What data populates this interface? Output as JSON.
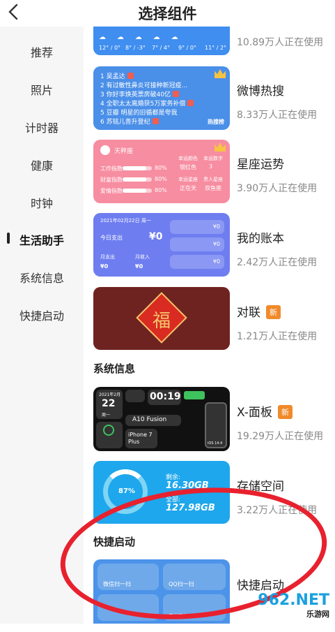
{
  "header": {
    "back_icon": "chevron-left",
    "title": "选择组件"
  },
  "sidebar": {
    "items": [
      {
        "label": "推荐"
      },
      {
        "label": "照片"
      },
      {
        "label": "计时器"
      },
      {
        "label": "健康"
      },
      {
        "label": "时钟"
      },
      {
        "label": "生活助手",
        "active": true
      },
      {
        "label": "系统信息"
      },
      {
        "label": "快捷启动"
      }
    ]
  },
  "widgets": [
    {
      "name": "",
      "users": "10.89万人正在使用"
    },
    {
      "name": "微博热搜",
      "users": "8.33万人正在使用"
    },
    {
      "name": "星座运势",
      "users": "3.90万人正在使用"
    },
    {
      "name": "我的账本",
      "users": "2.42万人正在使用"
    },
    {
      "name": "对联",
      "badge": "新",
      "users": "1.21万人正在使用"
    },
    {
      "name": "X-面板",
      "badge": "新",
      "users": "19.29万人正在使用"
    },
    {
      "name": "存储空间",
      "users": "3.22万人正在使用"
    },
    {
      "name": "快捷启动",
      "users": ""
    }
  ],
  "sections": {
    "system_info": "系统信息",
    "quick_launch": "快捷启动"
  },
  "weather_preview": {
    "temps": [
      "12° / 0°",
      "8° / -3°",
      "7° / 4°",
      "9° / 0°",
      "11° / 2°"
    ]
  },
  "weibo_preview": {
    "items": [
      "1 吴孟达",
      "2 有过敏性鼻炎可接种新冠疫...",
      "3 你好李焕英票房破40亿",
      "4 全职太太离婚获5万家务补偿",
      "5 豆瓣 明星的旧循都是夸我",
      "6 苏铭儿善升登纪"
    ],
    "logo_text": "热搜榜"
  },
  "horoscope_preview": {
    "sign": "天秤座",
    "rows": [
      {
        "label": "工作指数",
        "value": 0.8,
        "text": "80%"
      },
      {
        "label": "财富指数",
        "value": 0.8,
        "text": "80%"
      },
      {
        "label": "爱情指数",
        "value": 0.8,
        "text": "80%"
      }
    ],
    "cells": [
      {
        "k": "幸运颜色",
        "v": "银红色"
      },
      {
        "k": "幸运数字",
        "v": "3"
      },
      {
        "k": "幸运星座",
        "v": "正在天"
      },
      {
        "k": "贵人星座",
        "v": "双鱼座"
      }
    ]
  },
  "ledger_preview": {
    "date": "2021年02月22日  周一",
    "today_label": "今日支出",
    "today_value": "¥0",
    "month_out_label": "月支出",
    "month_out": "¥0",
    "month_in_label": "月收入",
    "month_in": "¥0",
    "right_values": [
      "¥0",
      "¥0",
      "¥0"
    ]
  },
  "couplet_preview": {
    "char": "福"
  },
  "xpanel_preview": {
    "date": "2021年2月",
    "day": "22",
    "weekday": "周一",
    "time": "00:19",
    "chip": "A10 Fusion",
    "model": "iPhone 7 Plus",
    "ios": "iOS 14.4"
  },
  "storage_preview": {
    "percent": "87%",
    "used_fraction": 0.87,
    "free_label": "剩余:",
    "free_value": "16.30GB",
    "total_label": "全部:",
    "total_value": "127.98GB"
  },
  "quick_preview": {
    "tiles": [
      "微信扫一扫",
      "QQ扫一扫",
      "",
      "支付宝扫一扫"
    ]
  },
  "watermark": {
    "text": "962.NET",
    "sub": "乐游网"
  },
  "colors": {
    "annotation_circle": "#e8212e",
    "badge": "#f08a2a"
  }
}
